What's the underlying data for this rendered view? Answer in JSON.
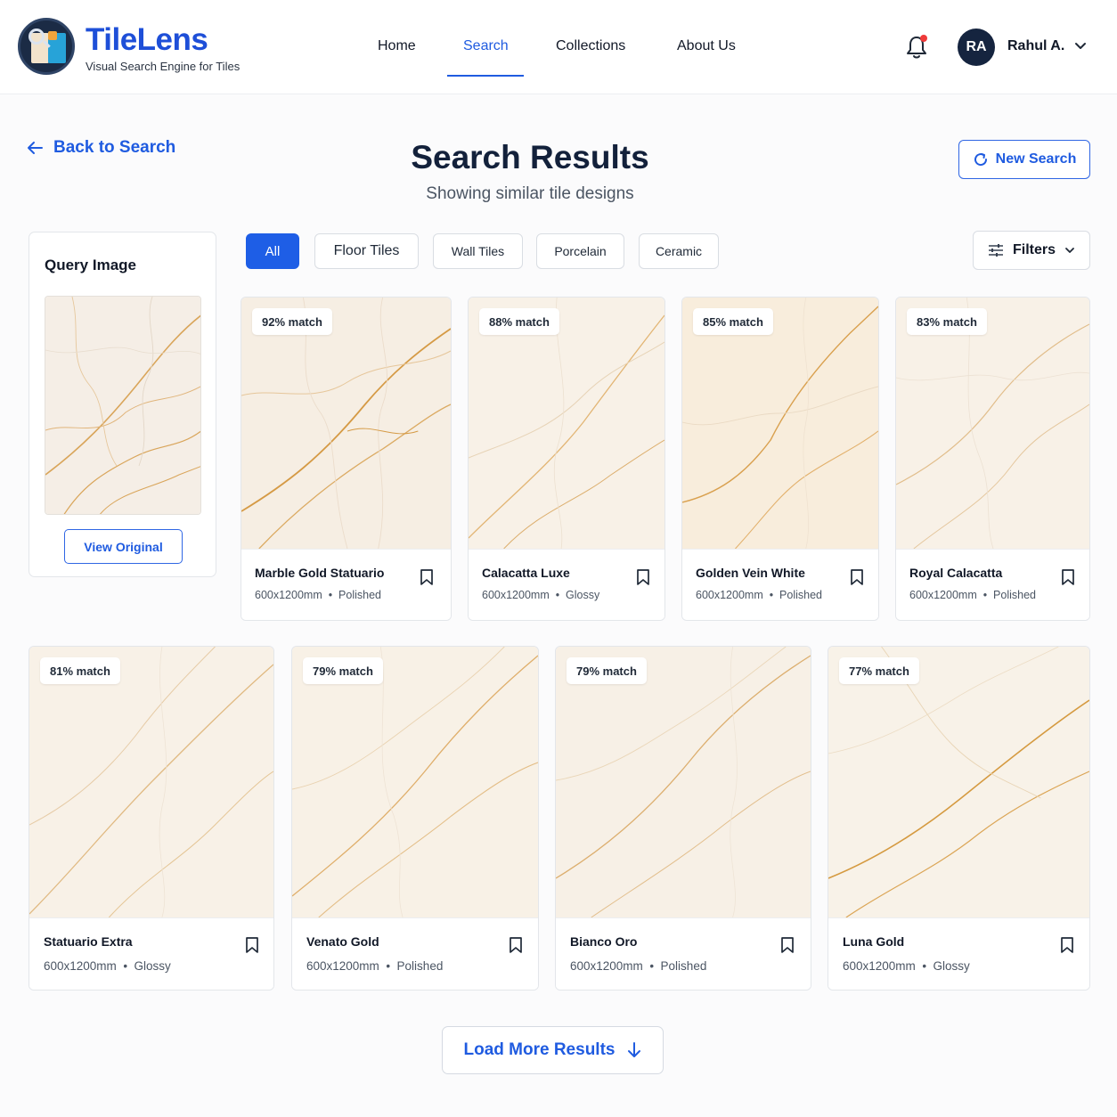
{
  "brand": {
    "name": "TileLens",
    "tagline": "Visual Search Engine for Tiles"
  },
  "nav": {
    "items": [
      {
        "label": "Home",
        "active": false
      },
      {
        "label": "Search",
        "active": true
      },
      {
        "label": "Collections",
        "active": false
      },
      {
        "label": "About Us",
        "active": false
      }
    ]
  },
  "user": {
    "initials": "RA",
    "name": "Rahul A.",
    "has_notification": true
  },
  "page": {
    "back_label": "Back to Search",
    "title": "Search Results",
    "subtitle": "Showing similar tile designs",
    "new_search_label": "New Search"
  },
  "query": {
    "title": "Query Image",
    "view_original_label": "View Original"
  },
  "filters": {
    "chips": [
      {
        "label": "All",
        "active": true
      },
      {
        "label": "Floor Tiles",
        "active": false
      },
      {
        "label": "Wall Tiles",
        "active": false
      },
      {
        "label": "Porcelain",
        "active": false
      },
      {
        "label": "Ceramic",
        "active": false
      }
    ],
    "filters_label": "Filters"
  },
  "results": [
    {
      "match": "92% match",
      "name": "Marble Gold Statuario",
      "size": "600x1200mm",
      "finish": "Polished"
    },
    {
      "match": "88% match",
      "name": "Calacatta Luxe",
      "size": "600x1200mm",
      "finish": "Glossy"
    },
    {
      "match": "85% match",
      "name": "Golden Vein White",
      "size": "600x1200mm",
      "finish": "Polished"
    },
    {
      "match": "83% match",
      "name": "Royal Calacatta",
      "size": "600x1200mm",
      "finish": "Polished"
    },
    {
      "match": "81% match",
      "name": "Statuario Extra",
      "size": "600x1200mm",
      "finish": "Glossy"
    },
    {
      "match": "79% match",
      "name": "Venato Gold",
      "size": "600x1200mm",
      "finish": "Polished"
    },
    {
      "match": "79% match",
      "name": "Bianco Oro",
      "size": "600x1200mm",
      "finish": "Polished"
    },
    {
      "match": "77% match",
      "name": "Luna Gold",
      "size": "600x1200mm",
      "finish": "Glossy"
    }
  ],
  "load_more_label": "Load More Results",
  "colors": {
    "accent": "#1f5be0",
    "navy": "#13213b",
    "marble_base": "#f7efe3",
    "vein_gold": "#d8a24e"
  },
  "icons": [
    "bell-icon",
    "chevron-down-icon",
    "arrow-left-icon",
    "refresh-icon",
    "sliders-icon",
    "bookmark-icon",
    "arrow-down-icon"
  ]
}
